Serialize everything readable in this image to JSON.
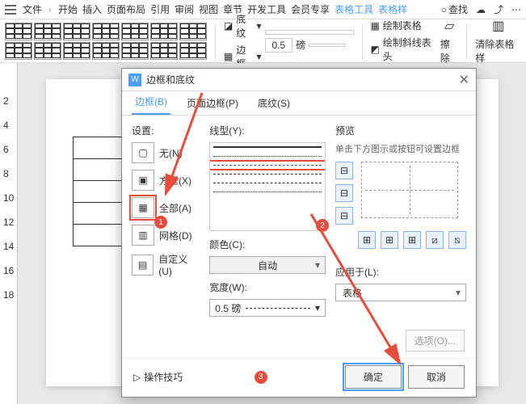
{
  "topbar": {
    "file": "文件",
    "tabs": [
      "开始",
      "插入",
      "页面布局",
      "引用",
      "审阅",
      "视图",
      "章节",
      "开发工具",
      "会员专享",
      "表格工具",
      "表格样"
    ],
    "active_index": 10,
    "search": "查找"
  },
  "ribbon": {
    "shading_label": "底纹",
    "border_label": "边框",
    "width_value": "0.5",
    "width_unit": "磅",
    "draw_table": "绘制表格",
    "draw_diagonal": "绘制斜线表头",
    "eraser": "擦除",
    "clear_style": "清除表格样"
  },
  "dialog": {
    "title": "边框和底纹",
    "tabs": {
      "border": "边框(B)",
      "page": "页面边框(P)",
      "shading": "底纹(S)"
    },
    "set_label": "设置:",
    "set_items": {
      "none": "无(N)",
      "box": "方框(X)",
      "all": "全部(A)",
      "grid": "网格(D)",
      "custom": "自定义(U)"
    },
    "style_label": "线型(Y):",
    "color_label": "颜色(C):",
    "color_value": "自动",
    "width_label": "宽度(W):",
    "width_value": "0.5 磅",
    "preview_label": "预览",
    "preview_hint": "单击下方图示或按钮可设置边框",
    "apply_label": "应用于(L):",
    "apply_value": "表格",
    "options": "选项(O)...",
    "tips": "操作技巧",
    "ok": "确定",
    "cancel": "取消"
  },
  "badges": {
    "b1": "1",
    "b2": "2",
    "b3": "3"
  }
}
